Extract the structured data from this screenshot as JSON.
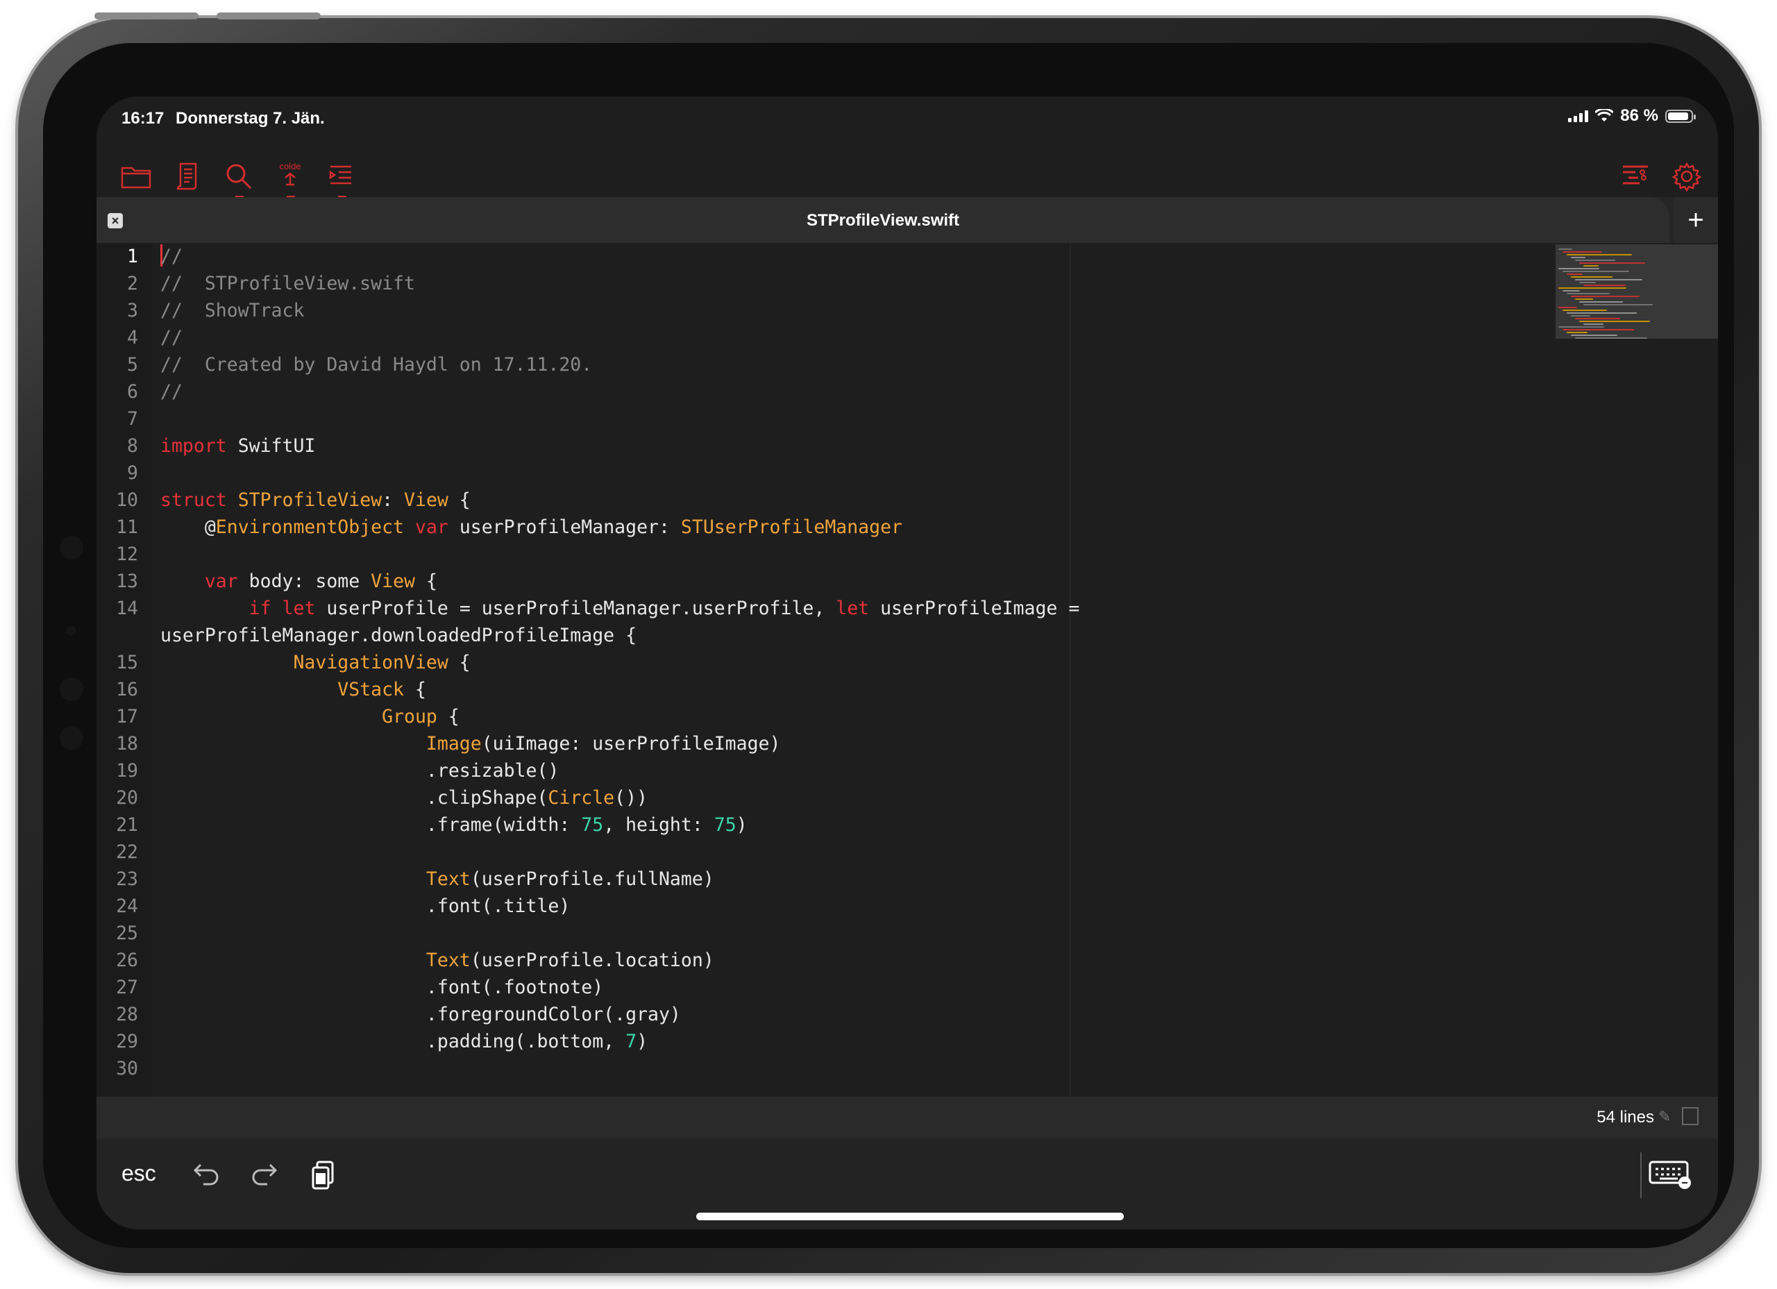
{
  "status_bar": {
    "time": "16:17",
    "date": "Donnerstag 7. Jän.",
    "battery": "86 %"
  },
  "toolbar": {
    "icons": [
      "folder-icon",
      "scroll-icon",
      "search-icon",
      "code-snippet-icon",
      "indent-icon",
      "structure-icon",
      "gear-icon"
    ],
    "snippet_label": "colde",
    "accent_color": "#d32c2c"
  },
  "tab": {
    "title": "STProfileView.swift",
    "close_label": "×",
    "add_label": "+"
  },
  "editor": {
    "lines": [
      {
        "n": "1",
        "html": "<span class='caret'></span><span class='c'>//</span>"
      },
      {
        "n": "2",
        "html": "<span class='c'>//  STProfileView.swift</span>"
      },
      {
        "n": "3",
        "html": "<span class='c'>//  ShowTrack</span>"
      },
      {
        "n": "4",
        "html": "<span class='c'>//</span>"
      },
      {
        "n": "5",
        "html": "<span class='c'>//  Created by David Haydl on 17.11.20.</span>"
      },
      {
        "n": "6",
        "html": "<span class='c'>//</span>"
      },
      {
        "n": "7",
        "html": ""
      },
      {
        "n": "8",
        "html": "<span class='k'>import</span> SwiftUI"
      },
      {
        "n": "9",
        "html": ""
      },
      {
        "n": "10",
        "html": "<span class='k'>struct</span> <span class='t'>STProfileView</span>: <span class='t'>View</span> {"
      },
      {
        "n": "11",
        "html": "    @<span class='t'>EnvironmentObject</span> <span class='k'>var</span> userProfileManager: <span class='t'>STUserProfileManager</span>"
      },
      {
        "n": "12",
        "html": ""
      },
      {
        "n": "13",
        "html": "    <span class='k'>var</span> body: some <span class='t'>View</span> {"
      },
      {
        "n": "14",
        "html": "        <span class='k'>if</span> <span class='k'>let</span> userProfile = userProfileManager.userProfile, <span class='k'>let</span> userProfileImage ="
      },
      {
        "n": "",
        "html": "userProfileManager.downloadedProfileImage {"
      },
      {
        "n": "15",
        "html": "            <span class='t'>NavigationView</span> {"
      },
      {
        "n": "16",
        "html": "                <span class='t'>VStack</span> {"
      },
      {
        "n": "17",
        "html": "                    <span class='t'>Group</span> {"
      },
      {
        "n": "18",
        "html": "                        <span class='t'>Image</span>(uiImage: userProfileImage)"
      },
      {
        "n": "19",
        "html": "                        .resizable()"
      },
      {
        "n": "20",
        "html": "                        .clipShape(<span class='t'>Circle</span>())"
      },
      {
        "n": "21",
        "html": "                        .frame(width: <span class='n'>75</span>, height: <span class='n'>75</span>)"
      },
      {
        "n": "22",
        "html": ""
      },
      {
        "n": "23",
        "html": "                        <span class='t'>Text</span>(userProfile.fullName)"
      },
      {
        "n": "24",
        "html": "                        .font(.title)"
      },
      {
        "n": "25",
        "html": ""
      },
      {
        "n": "26",
        "html": "                        <span class='t'>Text</span>(userProfile.location)"
      },
      {
        "n": "27",
        "html": "                        .font(.footnote)"
      },
      {
        "n": "28",
        "html": "                        .foregroundColor(.gray)"
      },
      {
        "n": "29",
        "html": "                        .padding(.bottom, <span class='n'>7</span>)"
      },
      {
        "n": "30",
        "html": ""
      }
    ],
    "colors": {
      "keyword": "#e8323a",
      "type": "#f0a43c",
      "comment": "#8a8a8a",
      "number": "#3ad6a7"
    }
  },
  "footer": {
    "line_count": "54 lines"
  },
  "keyboard_bar": {
    "esc_label": "esc"
  }
}
